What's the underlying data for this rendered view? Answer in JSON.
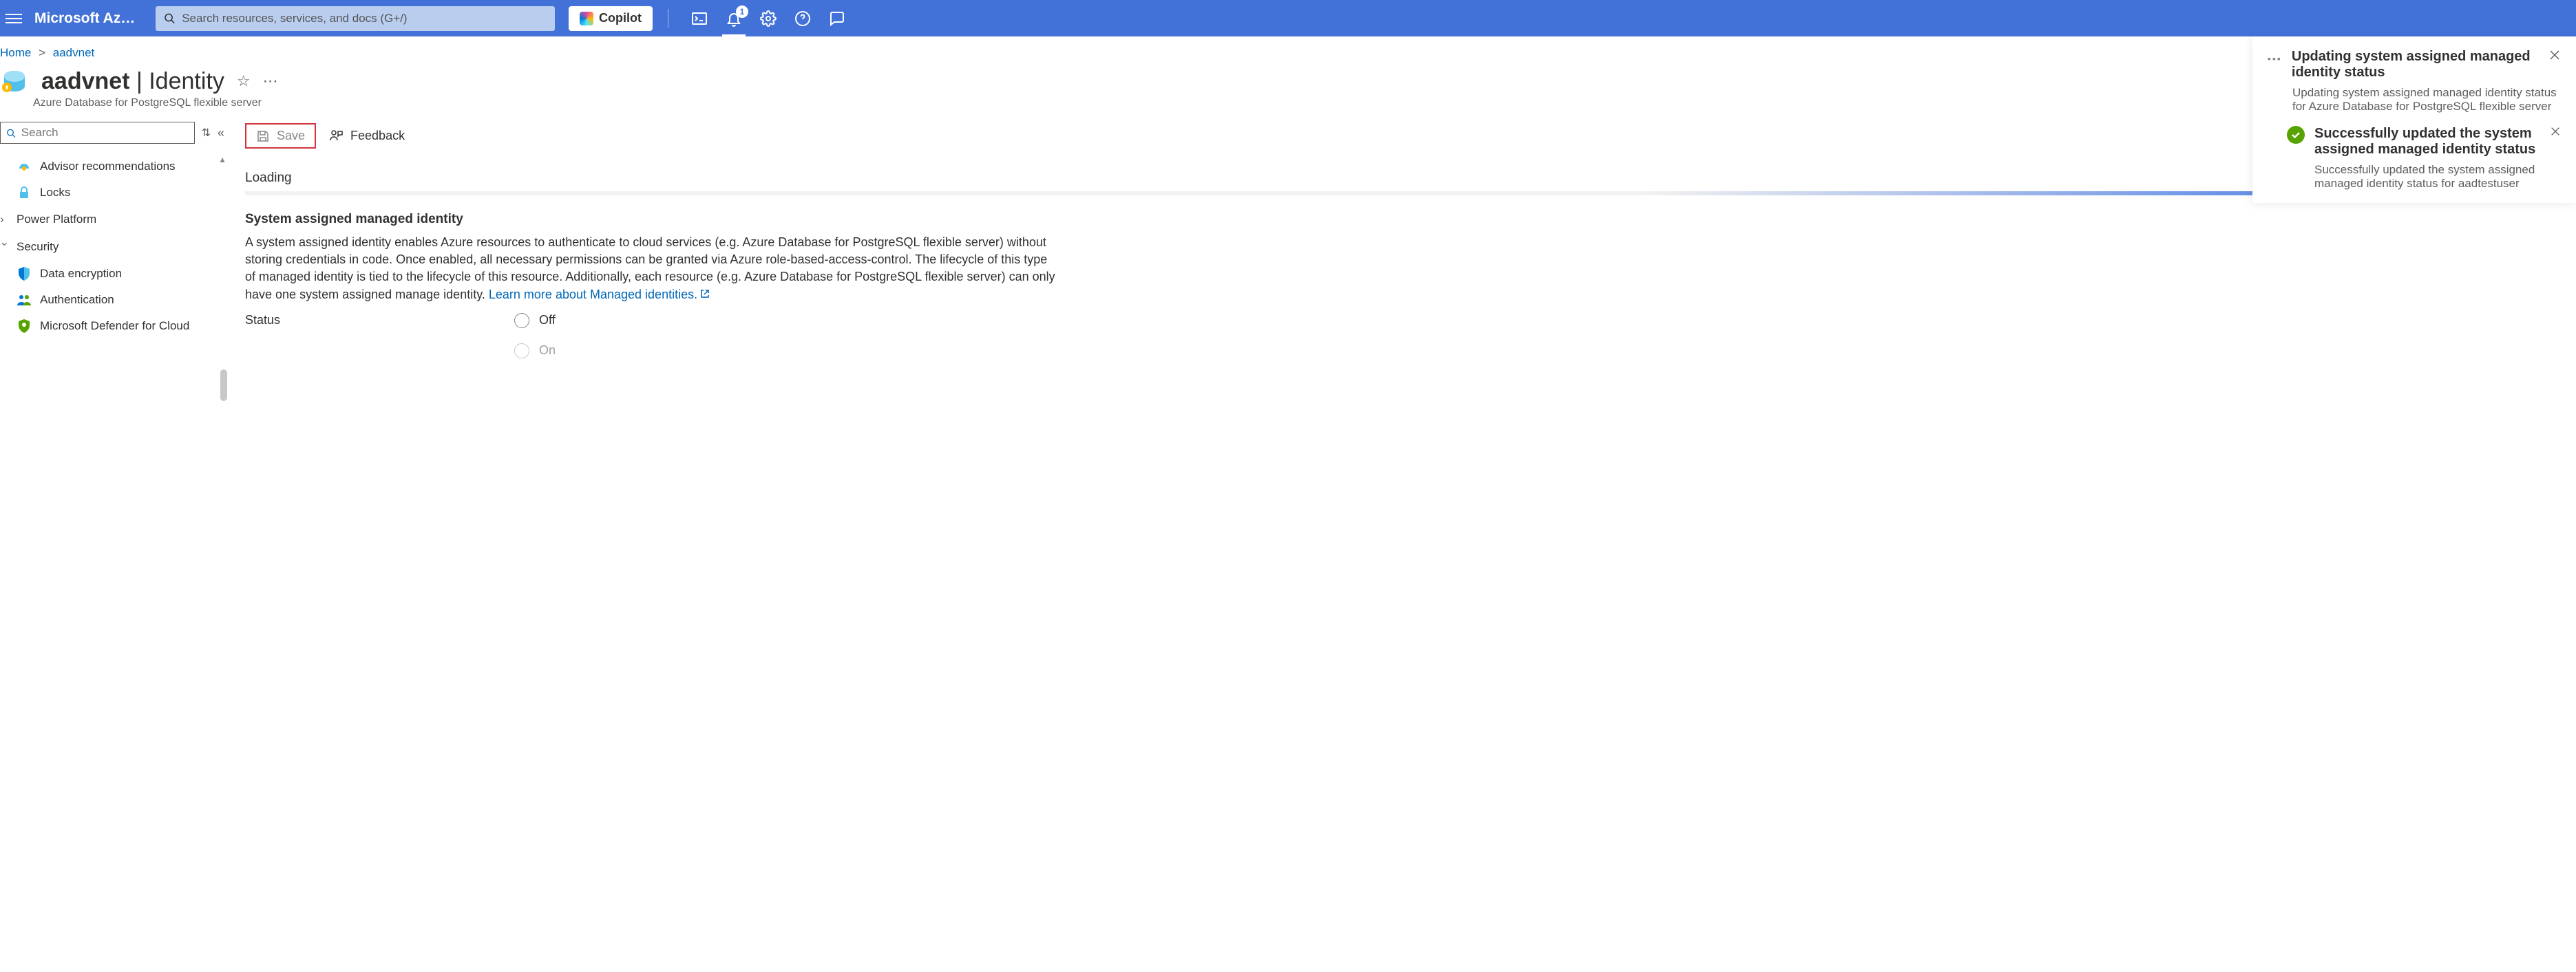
{
  "header": {
    "brand": "Microsoft Azu…",
    "search_placeholder": "Search resources, services, and docs (G+/)",
    "copilot_label": "Copilot",
    "notification_badge": "1"
  },
  "breadcrumb": {
    "home": "Home",
    "resource": "aadvnet"
  },
  "page": {
    "title_bold": "aadvnet",
    "title_sep": " | ",
    "title_light": "Identity",
    "subtitle": "Azure Database for PostgreSQL flexible server"
  },
  "sidebar": {
    "search_placeholder": "Search",
    "items": {
      "advisor": "Advisor recommendations",
      "locks": "Locks"
    },
    "groups": {
      "power_platform": "Power Platform",
      "security": "Security"
    },
    "security_items": {
      "data_encryption": "Data encryption",
      "authentication": "Authentication",
      "defender": "Microsoft Defender for Cloud"
    }
  },
  "toolbar": {
    "save_label": "Save",
    "feedback_label": "Feedback"
  },
  "main": {
    "loading": "Loading",
    "section_heading": "System assigned managed identity",
    "section_body": "A system assigned identity enables Azure resources to authenticate to cloud services (e.g. Azure Database for PostgreSQL flexible server) without storing credentials in code. Once enabled, all necessary permissions can be granted via Azure role-based-access-control. The lifecycle of this type of managed identity is tied to the lifecycle of this resource. Additionally, each resource (e.g. Azure Database for PostgreSQL flexible server) can only have one system assigned manage identity.",
    "learn_more": "Learn more about Managed identities.",
    "status_label": "Status",
    "status_off": "Off",
    "status_on": "On"
  },
  "notification": {
    "title": "Updating system assigned managed identity status",
    "description": "Updating system assigned managed identity status for Azure Database for PostgreSQL flexible server",
    "sub_title": "Successfully updated the system assigned managed identity status",
    "sub_description": "Successfully updated the system assigned managed identity status for aadtestuser"
  }
}
